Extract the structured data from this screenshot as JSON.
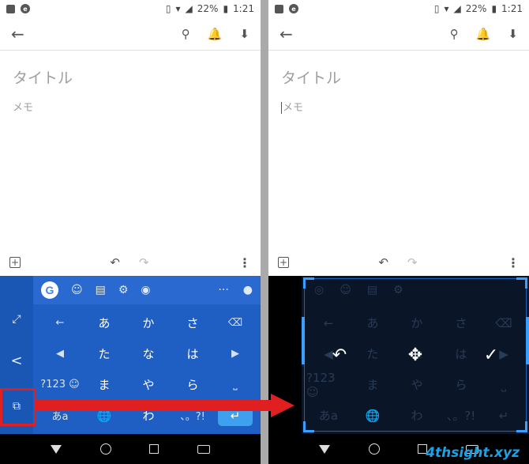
{
  "status": {
    "battery": "22%",
    "time": "1:21",
    "e_badge": "e"
  },
  "appbar": {
    "back": "←",
    "pin": "⚲",
    "reminder": "🔔",
    "archive": "⬇"
  },
  "note": {
    "title_placeholder": "タイトル",
    "memo_placeholder": "メモ"
  },
  "bottombar": {
    "add": "+",
    "undo": "↶",
    "redo": "↷",
    "more": "⋮"
  },
  "keyboard": {
    "google_logo": "G",
    "toolbar_icons": [
      "sticker-icon",
      "clipboard-icon",
      "gear-icon",
      "palette-icon"
    ],
    "toolbar_more": "···",
    "toolbar_mic": "🎤",
    "side_keys": {
      "expand": "⤢",
      "collapse": "<",
      "float": "⧉"
    },
    "rows": [
      [
        "←",
        "あ",
        "か",
        "さ",
        "⌫"
      ],
      [
        "◀",
        "た",
        "な",
        "は",
        "▶"
      ],
      [
        "?123 ☺",
        "ま",
        "や",
        "ら",
        "⎵"
      ],
      [
        "あa",
        "🌐",
        "わ",
        "、。?!",
        "↵"
      ]
    ]
  },
  "float_actions": {
    "undo": "↶",
    "move": "✥",
    "done": "✓"
  },
  "watermark": "4thsight.xyz"
}
